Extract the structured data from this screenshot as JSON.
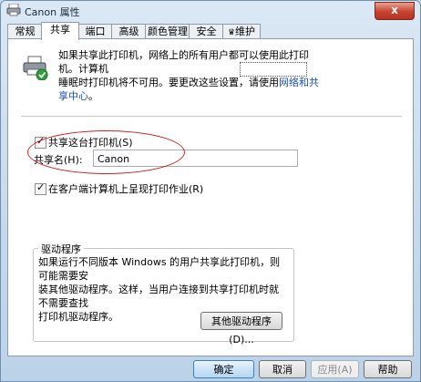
{
  "window": {
    "title": "Canon 属性",
    "close_label": "x"
  },
  "tabs": [
    {
      "label": "常规",
      "active": false
    },
    {
      "label": "共享",
      "active": true
    },
    {
      "label": "端口",
      "active": false
    },
    {
      "label": "高级",
      "active": false
    },
    {
      "label": "颜色管理",
      "active": false
    },
    {
      "label": "安全",
      "active": false
    },
    {
      "label": "维护",
      "active": false
    }
  ],
  "sharing": {
    "description_line1": "如果共享此打印机，网络上的所有用户都可以使用此打印机。计算机",
    "description_line2": "睡眠时打印机将不可用。要更改这些设置，请使用",
    "description_link": "网络和共享中心",
    "description_end": "。",
    "share_checkbox_label": "共享这台打印机(S)",
    "share_checkbox_checked": true,
    "share_name_label": "共享名(H):",
    "share_name_value": "Canon",
    "render_checkbox_label": "在客户端计算机上呈现打印作业(R)",
    "render_checkbox_checked": true
  },
  "drivers": {
    "title": "驱动程序",
    "text_line1": "如果运行不同版本 Windows 的用户共享此打印机，则可能需要安",
    "text_line2": "装其他驱动程序。这样，当用户连接到共享打印机时就不需要查找",
    "text_line3": "打印机驱动程序。",
    "additional_button": "其他驱动程序(D)..."
  },
  "footer": {
    "ok_button": "确定",
    "cancel_button": "取消",
    "apply_button": "应用(A)",
    "help_button": "帮助"
  },
  "colors": {
    "link": "#1a4fb5",
    "annotation": "#cc1f1f"
  }
}
